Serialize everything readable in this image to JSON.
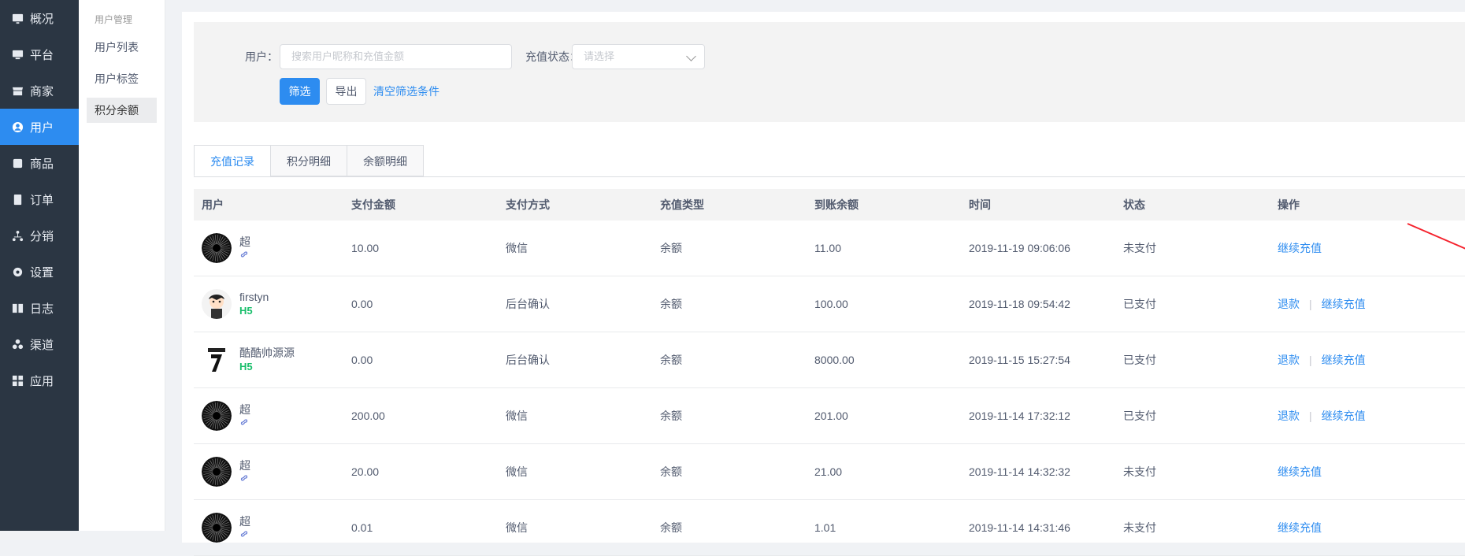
{
  "left_nav": [
    {
      "label": "概况",
      "icon": "dashboard-icon",
      "active": false
    },
    {
      "label": "平台",
      "icon": "monitor-icon",
      "active": false
    },
    {
      "label": "商家",
      "icon": "store-icon",
      "active": false
    },
    {
      "label": "用户",
      "icon": "user-icon",
      "active": true
    },
    {
      "label": "商品",
      "icon": "goods-icon",
      "active": false
    },
    {
      "label": "订单",
      "icon": "order-icon",
      "active": false
    },
    {
      "label": "分销",
      "icon": "distribution-icon",
      "active": false
    },
    {
      "label": "设置",
      "icon": "gear-icon",
      "active": false
    },
    {
      "label": "日志",
      "icon": "log-icon",
      "active": false
    },
    {
      "label": "渠道",
      "icon": "channel-icon",
      "active": false
    },
    {
      "label": "应用",
      "icon": "apps-icon",
      "active": false
    }
  ],
  "sub_nav": {
    "title": "用户管理",
    "items": [
      {
        "label": "用户列表",
        "active": false
      },
      {
        "label": "用户标签",
        "active": false
      },
      {
        "label": "积分余额",
        "active": true
      }
    ]
  },
  "filter": {
    "user_label": "用户：",
    "user_placeholder": "搜索用户昵称和充值金额",
    "status_label": "充值状态：",
    "status_placeholder": "请选择",
    "filter_button": "筛选",
    "export_button": "导出",
    "clear_link": "清空筛选条件"
  },
  "tabs": [
    {
      "label": "充值记录",
      "active": true
    },
    {
      "label": "积分明细",
      "active": false
    },
    {
      "label": "余额明细",
      "active": false
    }
  ],
  "table": {
    "headers": [
      "用户",
      "支付金额",
      "支付方式",
      "充值类型",
      "到账余额",
      "时间",
      "状态",
      "操作"
    ],
    "rows": [
      {
        "name": "超",
        "tag": "mini",
        "pay": "10.00",
        "method": "微信",
        "type": "余额",
        "balance": "11.00",
        "time": "2019-11-19 09:06:06",
        "status": "未支付",
        "ops": [
          "继续充值"
        ],
        "avatar": "black-circle"
      },
      {
        "name": "firstyn",
        "tag": "H5",
        "pay": "0.00",
        "method": "后台确认",
        "type": "余额",
        "balance": "100.00",
        "time": "2019-11-18 09:54:42",
        "status": "已支付",
        "ops": [
          "退款",
          "继续充值"
        ],
        "avatar": "cartoon"
      },
      {
        "name": "酷酷帅源源",
        "tag": "H5",
        "pay": "0.00",
        "method": "后台确认",
        "type": "余额",
        "balance": "8000.00",
        "time": "2019-11-15 15:27:54",
        "status": "已支付",
        "ops": [
          "退款",
          "继续充值"
        ],
        "avatar": "jersey"
      },
      {
        "name": "超",
        "tag": "mini",
        "pay": "200.00",
        "method": "微信",
        "type": "余额",
        "balance": "201.00",
        "time": "2019-11-14 17:32:12",
        "status": "已支付",
        "ops": [
          "退款",
          "继续充值"
        ],
        "avatar": "black-circle"
      },
      {
        "name": "超",
        "tag": "mini",
        "pay": "20.00",
        "method": "微信",
        "type": "余额",
        "balance": "21.00",
        "time": "2019-11-14 14:32:32",
        "status": "未支付",
        "ops": [
          "继续充值"
        ],
        "avatar": "black-circle"
      },
      {
        "name": "超",
        "tag": "mini",
        "pay": "0.01",
        "method": "微信",
        "type": "余额",
        "balance": "1.01",
        "time": "2019-11-14 14:31:46",
        "status": "未支付",
        "ops": [
          "继续充值"
        ],
        "avatar": "black-circle"
      }
    ]
  },
  "colors": {
    "nav_bg": "#2b3643",
    "accent": "#2d8cf0",
    "h5_tag": "#19be6b",
    "arrow": "#f5222d"
  }
}
